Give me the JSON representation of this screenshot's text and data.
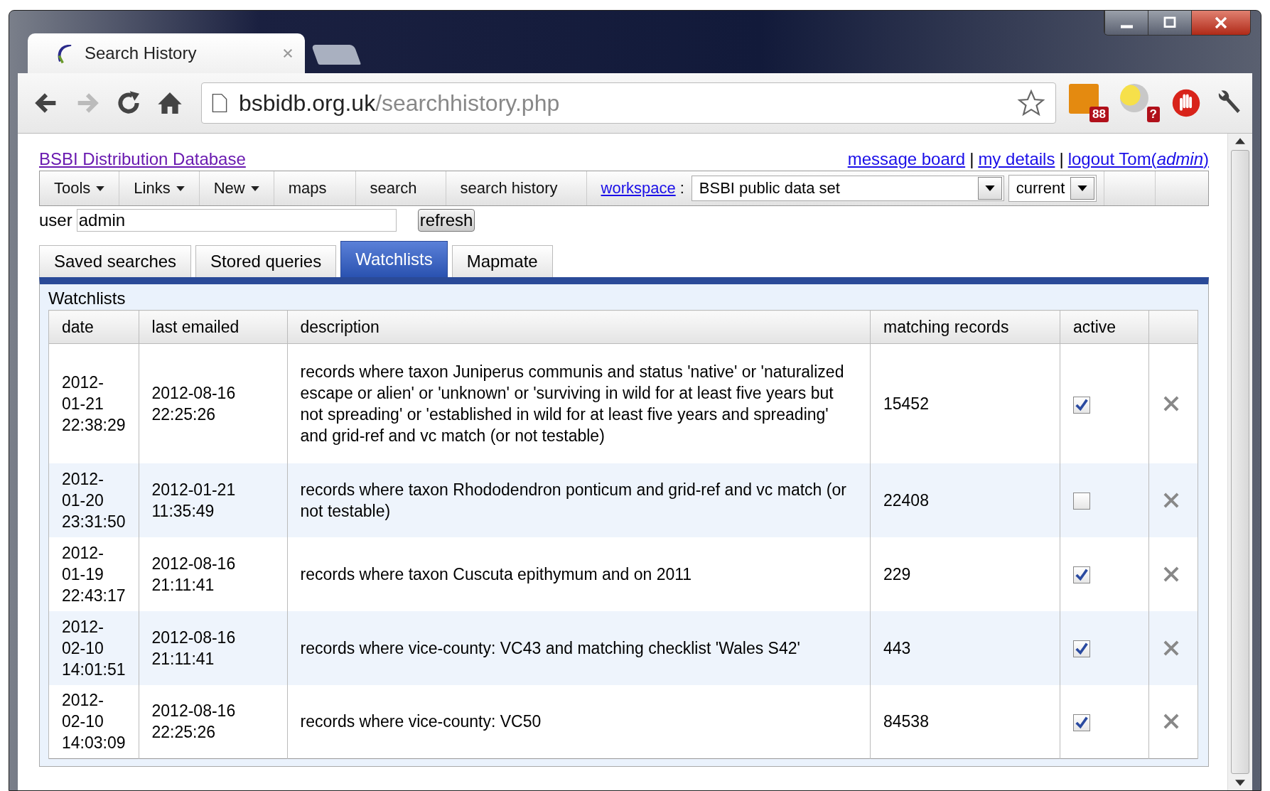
{
  "browser": {
    "tab_title": "Search History",
    "url_host": "bsbidb.org.uk",
    "url_path": "/searchhistory.php",
    "extension_badges": [
      "88",
      "?"
    ]
  },
  "header": {
    "site_link": "BSBI Distribution Database",
    "user_links": [
      "message board",
      "my details",
      "logout Tom(*admin*)"
    ],
    "separators": [
      "|",
      "|"
    ]
  },
  "menu": [
    {
      "label": "Tools",
      "kind": "dropdown"
    },
    {
      "label": "Links",
      "kind": "dropdown"
    },
    {
      "label": "New",
      "kind": "dropdown"
    },
    {
      "label": "maps",
      "kind": "plain"
    },
    {
      "label": "search",
      "kind": "plain"
    },
    {
      "label": "search history",
      "kind": "plain"
    }
  ],
  "workspace": {
    "label": "workspace",
    "separator": ":",
    "value": "BSBI public data set",
    "version": "current"
  },
  "user_filter": {
    "label": "user",
    "value": "admin",
    "button": "refresh"
  },
  "tabs": [
    {
      "label": "Saved searches",
      "selected": false
    },
    {
      "label": "Stored queries",
      "selected": false
    },
    {
      "label": "Watchlists",
      "selected": true
    },
    {
      "label": "Mapmate",
      "selected": false
    }
  ],
  "panel": {
    "title": "Watchlists",
    "table": {
      "columns": [
        "date",
        "last emailed",
        "description",
        "matching records",
        "active"
      ],
      "rows": [
        {
          "date": "2012-01-21 22:38:29",
          "last_emailed": "2012-08-16 22:25:26",
          "description": "records where taxon Juniperus communis and status 'native' or 'naturalized escape or alien' or 'unknown' or 'surviving in wild for at least five years but not spreading' or 'established in wild for at least five years and spreading' and grid-ref and vc match (or not testable)",
          "matching_records": "15452",
          "active": true
        },
        {
          "date": "2012-01-20 23:31:50",
          "last_emailed": "2012-01-21 11:35:49",
          "description": "records where taxon Rhododendron ponticum and grid-ref and vc match (or not testable)",
          "matching_records": "22408",
          "active": false
        },
        {
          "date": "2012-01-19 22:43:17",
          "last_emailed": "2012-08-16 21:11:41",
          "description": "records where taxon Cuscuta epithymum and on 2011",
          "matching_records": "229",
          "active": true
        },
        {
          "date": "2012-02-10 14:01:51",
          "last_emailed": "2012-08-16 21:11:41",
          "description": "records where vice-county: VC43 and matching checklist 'Wales S42'",
          "matching_records": "443",
          "active": true
        },
        {
          "date": "2012-02-10 14:03:09",
          "last_emailed": "2012-08-16 22:25:26",
          "description": "records where vice-county: VC50",
          "matching_records": "84538",
          "active": true
        }
      ]
    }
  }
}
